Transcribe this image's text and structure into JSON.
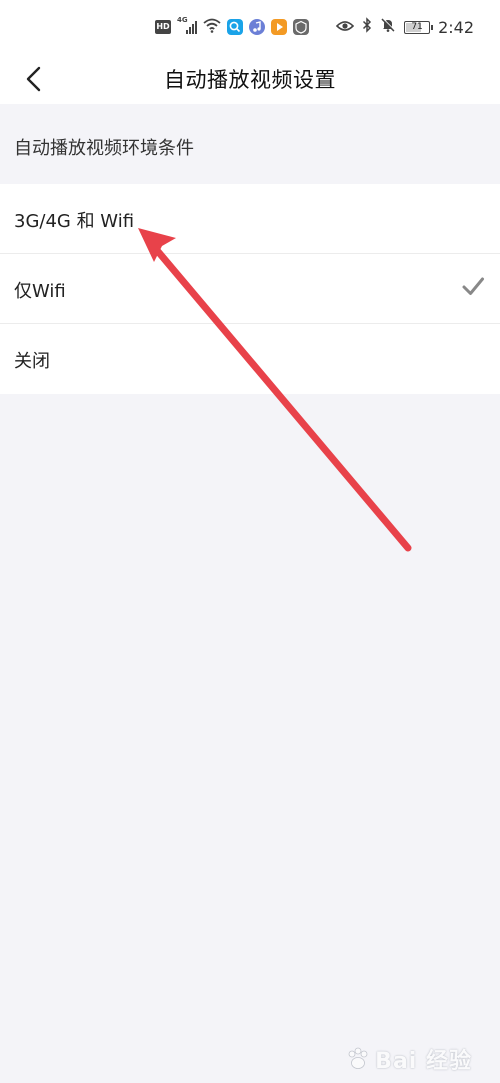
{
  "status_bar": {
    "left_icons": [
      "hd-badge",
      "4g-signal-icon",
      "wifi-icon",
      "search-app-icon",
      "music-app-icon",
      "play-app-icon",
      "shield-app-icon"
    ],
    "hd_label": "HD",
    "network_label": "4G",
    "right_icons": [
      "eye-icon",
      "bluetooth-icon",
      "mute-icon",
      "battery-icon"
    ],
    "battery_level": "71",
    "time": "2:42"
  },
  "nav": {
    "title": "自动播放视频设置"
  },
  "section": {
    "header": "自动播放视频环境条件"
  },
  "options": [
    {
      "label": "3G/4G 和 Wifi",
      "selected": false
    },
    {
      "label": "仅Wifi",
      "selected": true
    },
    {
      "label": "关闭",
      "selected": false
    }
  ],
  "colors": {
    "background": "#f4f4f8",
    "surface": "#ffffff",
    "divider": "#ececec",
    "check": "#888888",
    "annotation_arrow": "#e8424a"
  },
  "watermark": {
    "text": "Bai 经验"
  }
}
